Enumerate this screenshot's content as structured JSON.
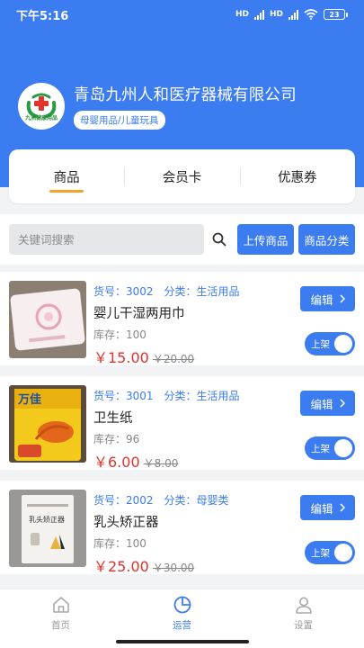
{
  "status_bar": {
    "time": "下午5:16",
    "network_1": "HD",
    "network_2": "HD",
    "battery": "23"
  },
  "store": {
    "name": "青岛九州人和医疗器械有限公司",
    "category_tag": "母婴用品/儿童玩具",
    "logo_text": "九洲健康用品"
  },
  "tabs": [
    {
      "label": "商品"
    },
    {
      "label": "会员卡"
    },
    {
      "label": "优惠券"
    }
  ],
  "search": {
    "placeholder": "关键词搜索",
    "value": ""
  },
  "actions": {
    "upload": "上传商品",
    "category": "商品分类"
  },
  "products": [
    {
      "code": "货号：3002",
      "category": "分类：生活用品",
      "name": "婴儿干湿两用巾",
      "stock": "库存：100",
      "price": "￥15.00",
      "old_price": "￥20.00",
      "edit_label": "编辑",
      "status_label": "上架",
      "thumb_text": ""
    },
    {
      "code": "货号：3001",
      "category": "分类：生活用品",
      "name": "卫生纸",
      "stock": "库存：96",
      "price": "￥6.00",
      "old_price": "￥8.00",
      "edit_label": "编辑",
      "status_label": "上架",
      "thumb_text": "万佳"
    },
    {
      "code": "货号：2002",
      "category": "分类：母婴类",
      "name": "乳头矫正器",
      "stock": "库存：100",
      "price": "￥25.00",
      "old_price": "￥30.00",
      "edit_label": "编辑",
      "status_label": "上架",
      "thumb_text": "乳头矫正器"
    }
  ],
  "tabbar": [
    {
      "label": "首页"
    },
    {
      "label": "运营"
    },
    {
      "label": "设置"
    }
  ],
  "colors": {
    "primary": "#3b7cf0",
    "price": "#e0342c",
    "accent": "#f5a12a"
  }
}
